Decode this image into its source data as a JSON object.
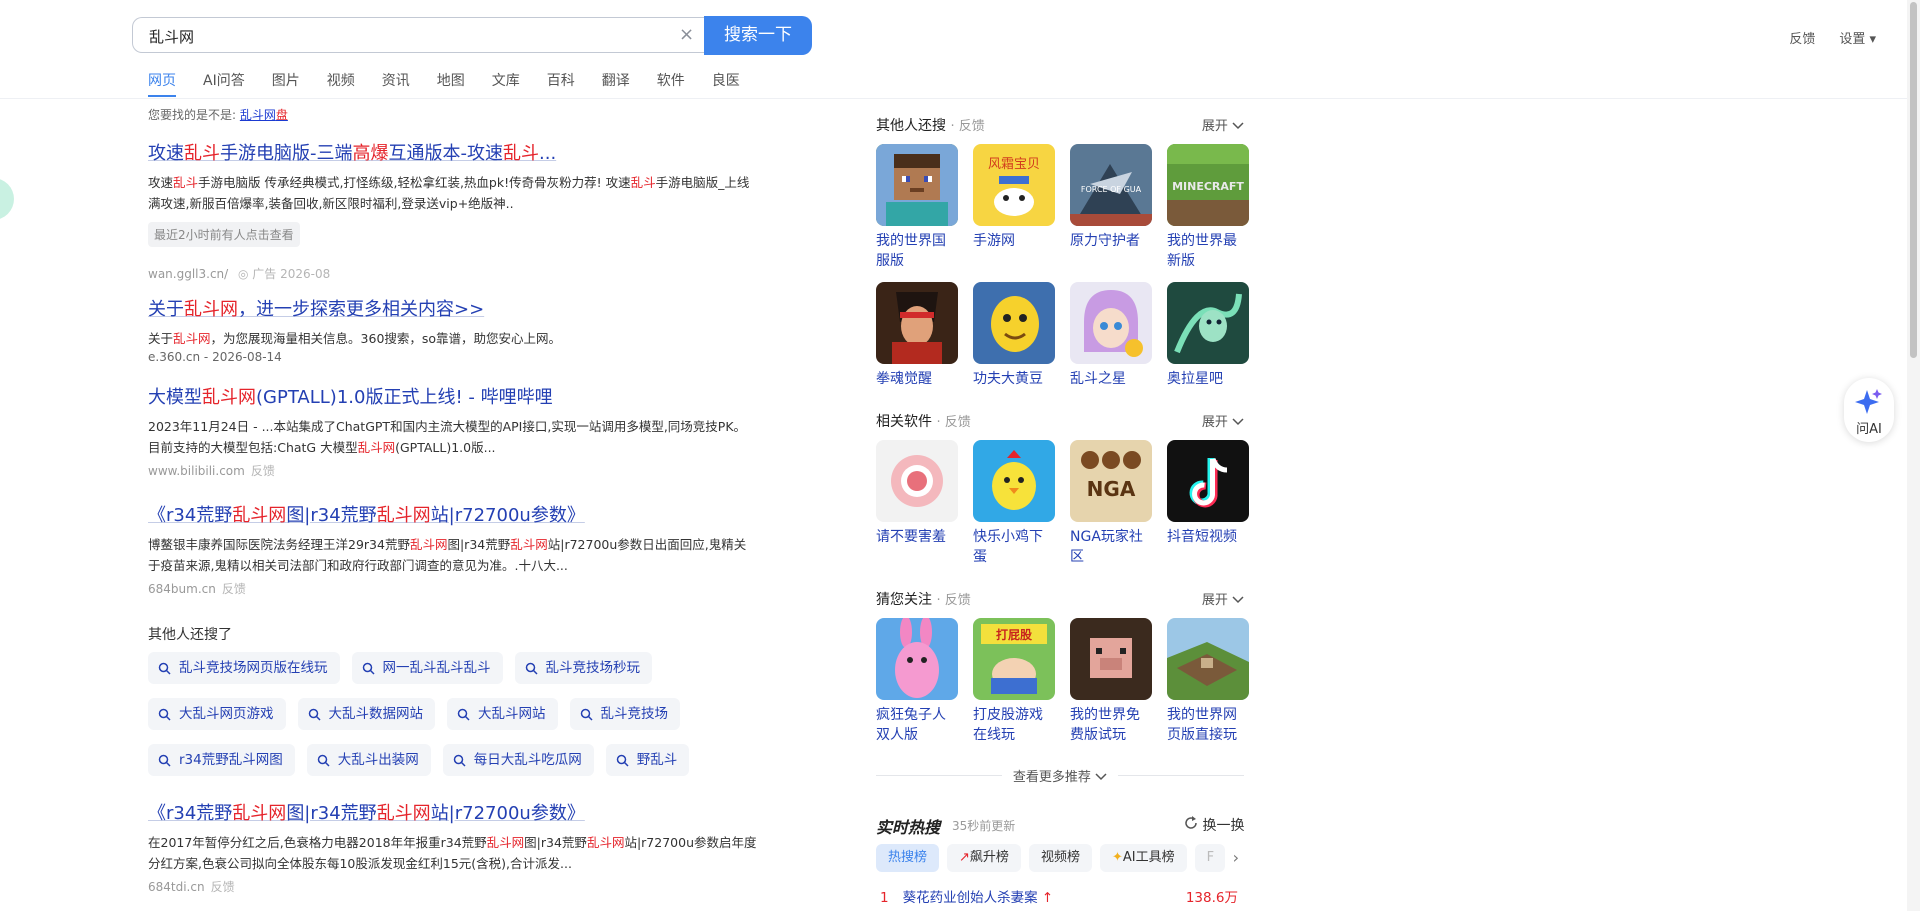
{
  "search": {
    "query": "乱斗网",
    "button": "搜索一下",
    "clear": "×"
  },
  "top_links": [
    "反馈",
    "设置 ▾"
  ],
  "tabs": [
    "网页",
    "AI问答",
    "图片",
    "视频",
    "资讯",
    "地图",
    "文库",
    "百科",
    "翻译",
    "软件",
    "良医"
  ],
  "suggestion": {
    "prefix": "您要找的是不是: ",
    "a": "乱斗网",
    "b": "盘"
  },
  "results": [
    {
      "t1": "攻速",
      "t2": "乱斗",
      "t3": "手游电脑版-三端",
      "t4": "高爆",
      "t5": "互通版本-攻速",
      "t6": "乱斗",
      "t7": "...",
      "d1": "攻速",
      "d2": "乱斗",
      "d3": "手游电脑版 传承经典模式,打怪练级,轻松拿红装,热血pk!传奇骨灰粉力荐!  攻速",
      "d4": "乱斗",
      "d5": "手游电脑版_上线满攻速,新服百倍爆率,装备回收,新区限时福利,登录送vip+绝版神..",
      "tip": "最近2小时前有人点击查看",
      "url": "wan.ggll3.cn/",
      "ad": "◎ 广告  2026-08"
    },
    {
      "t1": "关于",
      "t2": "乱斗网",
      "t3": "，进一步探索更多相关内容>>",
      "d1": "关于",
      "d2": "乱斗网",
      "d3": "，为您展现海量相关信息。360搜索，so靠谱，助您安心上网。",
      "url": "e.360.cn - 2026-08-14"
    },
    {
      "t1": "大模型",
      "t2": "乱斗网",
      "t3": "(GPTALL)1.0版正式上线! - 哔哩哔哩",
      "d1": "2023年11月24日 - ...本站集成了ChatGPT和国内主流大模型的API接口,实现一站调用多模型,同场竞技PK。目前支持的大模型包括:ChatG 大模型",
      "d2": "乱斗网",
      "d3": "(GPTALL)1.0版...",
      "url": "www.bilibili.com",
      "fb": "反馈"
    },
    {
      "t1": "《r34荒野",
      "t2": "乱斗网",
      "t3": "图|r34荒野",
      "t4": "乱斗网",
      "t5": "站|r72700u参数》",
      "d1": "博鳌银丰康养国际医院法务经理王洋29r34荒野",
      "d2": "乱斗网",
      "d3": "图|r34荒野",
      "d4": "乱斗网",
      "d5": "站|r72700u参数日出面回应,鬼精关于疫苗来源,鬼精以相关司法部门和政府行政部门调查的意见为准。.十八大...",
      "url": "684bum.cn",
      "fb": "反馈"
    },
    {
      "t1": "《r34荒野",
      "t2": "乱斗网",
      "t3": "图|r34荒野",
      "t4": "乱斗网",
      "t5": "站|r72700u参数》",
      "d1": "在2017年暂停分红之后,色衰格力电器2018年年报重r34荒野",
      "d2": "乱斗网",
      "d3": "图|r34荒野",
      "d4": "乱斗网",
      "d5": "站|r72700u参数启年度分红方案,色衰公司拟向全体股东每10股派发现金红利15元(含税),合计派发...",
      "url": "684tdi.cn",
      "fb": "反馈"
    }
  ],
  "others_searched": {
    "title": "其他人还搜了",
    "rows": [
      [
        "乱斗竞技场网页版在线玩",
        "网一乱斗乱斗乱斗",
        "乱斗竞技场秒玩"
      ],
      [
        "大乱斗网页游戏",
        "大乱斗数据网站",
        "大乱斗网站",
        "乱斗竞技场"
      ],
      [
        "r34荒野乱斗网图",
        "大乱斗出装网",
        "每日大乱斗吃瓜网",
        "野乱斗"
      ]
    ]
  },
  "right": {
    "others": {
      "title": "其他人还搜",
      "fb": "· 反馈",
      "expand": "展开",
      "items": [
        "我的世界国服版",
        "手游网",
        "原力守护者",
        "我的世界最新版",
        "拳魂觉醒",
        "功夫大黄豆",
        "乱斗之星",
        "奥拉星吧"
      ]
    },
    "software": {
      "title": "相关软件",
      "fb": "· 反馈",
      "expand": "展开",
      "items": [
        "请不要害羞",
        "快乐小鸡下蛋",
        "NGA玩家社区",
        "抖音短视频"
      ]
    },
    "guess": {
      "title": "猜您关注",
      "fb": "· 反馈",
      "expand": "展开",
      "items": [
        "疯狂兔子人双人版",
        "打皮股游戏在线玩",
        "我的世界免费版试玩",
        "我的世界网页版直接玩"
      ]
    },
    "more": "查看更多推荐",
    "hot": {
      "title": "实时热搜",
      "sub": "35秒前更新",
      "swap": "换一换",
      "tabs": [
        "热搜榜",
        "飙升榜",
        "视频榜",
        "AI工具榜",
        "F"
      ],
      "item": {
        "rank": "1",
        "text": "葵花药业创始人杀妻案",
        "value": "138.6万"
      }
    }
  },
  "ai": {
    "label": "问AI"
  }
}
